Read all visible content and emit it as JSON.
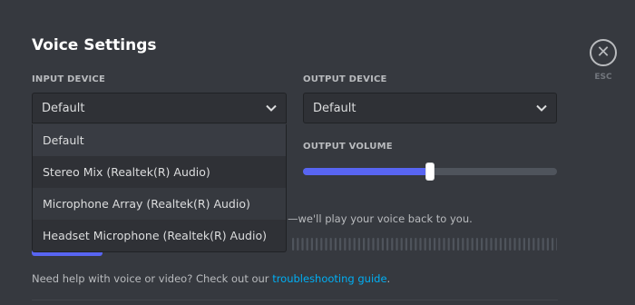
{
  "header": {
    "title": "Voice Settings",
    "close_label": "ESC"
  },
  "input_device": {
    "label": "INPUT DEVICE",
    "selected": "Default",
    "options": [
      "Default",
      "Stereo Mix (Realtek(R) Audio)",
      "Microphone Array (Realtek(R) Audio)",
      "Headset Microphone (Realtek(R) Audio)"
    ]
  },
  "output_device": {
    "label": "OUTPUT DEVICE",
    "selected": "Default"
  },
  "output_volume": {
    "label": "OUTPUT VOLUME",
    "value_fraction": 0.5
  },
  "mic_test": {
    "help_fragment": "—we'll play your voice back to you."
  },
  "footer": {
    "text": "Need help with voice or video? Check out our ",
    "link": "troubleshooting guide",
    "suffix": "."
  },
  "colors": {
    "background": "#36393f",
    "accent": "#5865f2",
    "link": "#00aff4"
  },
  "icons": {
    "close": "close-icon",
    "chevron": "chevron-down-icon"
  }
}
